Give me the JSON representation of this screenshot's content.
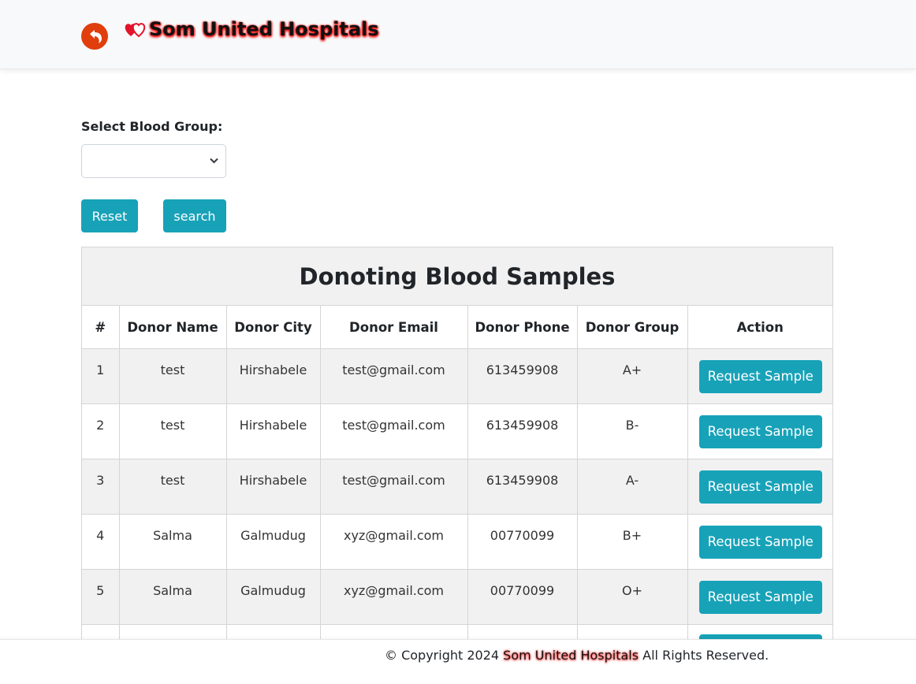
{
  "header": {
    "brand": "Som United Hospitals",
    "back_icon": "back-arrow-icon",
    "brand_icon": "hearts-icon"
  },
  "filter": {
    "label": "Select Blood Group:",
    "selected": ""
  },
  "buttons": {
    "reset": "Reset",
    "search": "search"
  },
  "table": {
    "title": "Donoting Blood Samples",
    "columns": [
      "#",
      "Donor Name",
      "Donor City",
      "Donor Email",
      "Donor Phone",
      "Donor Group",
      "Action"
    ],
    "rows": [
      {
        "num": "1",
        "name": "test",
        "city": "Hirshabele",
        "email": "test@gmail.com",
        "phone": "613459908",
        "group": "A+",
        "action": "Request Sample"
      },
      {
        "num": "2",
        "name": "test",
        "city": "Hirshabele",
        "email": "test@gmail.com",
        "phone": "613459908",
        "group": "B-",
        "action": "Request Sample"
      },
      {
        "num": "3",
        "name": "test",
        "city": "Hirshabele",
        "email": "test@gmail.com",
        "phone": "613459908",
        "group": "A-",
        "action": "Request Sample"
      },
      {
        "num": "4",
        "name": "Salma",
        "city": "Galmudug",
        "email": "xyz@gmail.com",
        "phone": "00770099",
        "group": "B+",
        "action": "Request Sample"
      },
      {
        "num": "5",
        "name": "Salma",
        "city": "Galmudug",
        "email": "xyz@gmail.com",
        "phone": "00770099",
        "group": "O+",
        "action": "Request Sample"
      },
      {
        "num": "",
        "name": "",
        "city": "",
        "email": "",
        "phone": "",
        "group": "",
        "action": ""
      }
    ]
  },
  "footer": {
    "prefix": "© Copyright 2024",
    "brand": "Som United Hospitals",
    "suffix": "All Rights Reserved."
  },
  "colors": {
    "accent": "#17a2b8",
    "back_icon": "#e03e0c",
    "brand_glow": "#ee1111"
  }
}
